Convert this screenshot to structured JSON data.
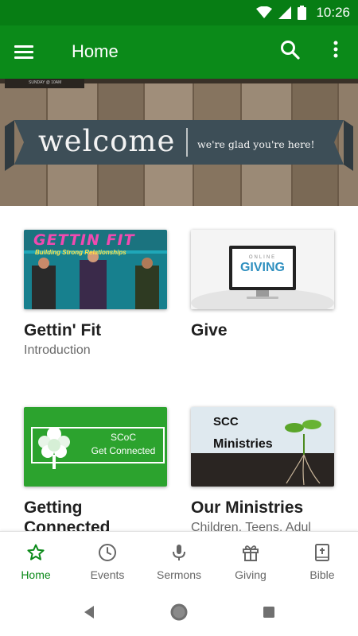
{
  "status_bar": {
    "time": "10:26",
    "icons": [
      "wifi-icon",
      "signal-icon",
      "battery-icon"
    ]
  },
  "app_bar": {
    "title": "Home",
    "menu_icon": "menu-icon",
    "search_icon": "search-icon",
    "more_icon": "more-vert-icon",
    "color": "#0b8a19"
  },
  "hero": {
    "welcome_text": "welcome",
    "subtitle": "we're glad you're here!",
    "small_text": "SUNDAY @ 10AM"
  },
  "cards": [
    {
      "title": "Gettin' Fit",
      "subtitle": "Introduction",
      "thumb_title": "GETTIN FIT",
      "thumb_sub": "Building Strong Relationships"
    },
    {
      "title": "Give",
      "subtitle": "",
      "thumb_top": "ONLINE",
      "thumb_main": "GIVING"
    },
    {
      "title": "Getting Connected",
      "subtitle": "",
      "thumb_line1": "SCoC",
      "thumb_line2": "Get Connected"
    },
    {
      "title": "Our Ministries",
      "subtitle": "Children, Teens, Adul",
      "thumb_line1": "SCC",
      "thumb_line2": "Ministries"
    }
  ],
  "bottom_nav": {
    "items": [
      {
        "label": "Home",
        "icon": "star-icon",
        "active": true
      },
      {
        "label": "Events",
        "icon": "clock-icon",
        "active": false
      },
      {
        "label": "Sermons",
        "icon": "microphone-icon",
        "active": false
      },
      {
        "label": "Giving",
        "icon": "gift-icon",
        "active": false
      },
      {
        "label": "Bible",
        "icon": "bible-icon",
        "active": false
      }
    ],
    "active_color": "#0b8a19"
  },
  "system_nav": {
    "icons": [
      "back-icon",
      "home-circle-icon",
      "recents-icon"
    ]
  }
}
